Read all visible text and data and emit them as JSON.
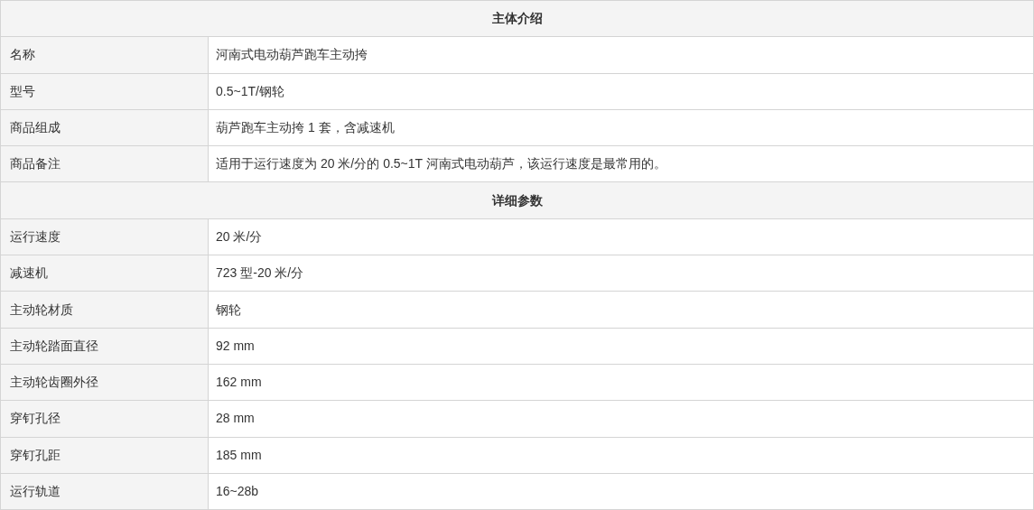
{
  "sections": [
    {
      "title": "主体介绍",
      "rows": [
        {
          "label": "名称",
          "value": "河南式电动葫芦跑车主动挎"
        },
        {
          "label": "型号",
          "value": "0.5~1T/钢轮"
        },
        {
          "label": "商品组成",
          "value": "葫芦跑车主动挎 1 套，含减速机"
        },
        {
          "label": "商品备注",
          "value": "适用于运行速度为 20 米/分的 0.5~1T 河南式电动葫芦，该运行速度是最常用的。"
        }
      ]
    },
    {
      "title": "详细参数",
      "rows": [
        {
          "label": "运行速度",
          "value": "20 米/分"
        },
        {
          "label": "减速机",
          "value": "723 型-20 米/分"
        },
        {
          "label": "主动轮材质",
          "value": "钢轮"
        },
        {
          "label": "主动轮踏面直径",
          "value": "92 mm"
        },
        {
          "label": "主动轮齿圈外径",
          "value": "162 mm"
        },
        {
          "label": "穿钉孔径",
          "value": "28 mm"
        },
        {
          "label": "穿钉孔距",
          "value": "185 mm"
        },
        {
          "label": "运行轨道",
          "value": "16~28b"
        }
      ]
    }
  ]
}
